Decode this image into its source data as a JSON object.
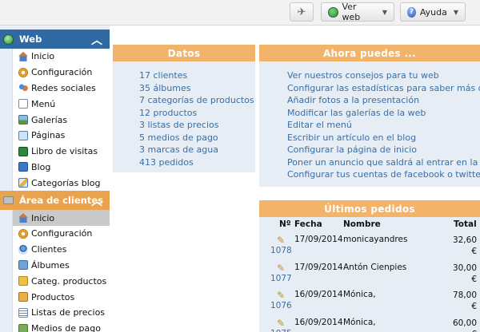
{
  "toolbar": {
    "send_icon": "paper-plane-icon",
    "view_web_label": "Ver web",
    "help_label": "Ayuda"
  },
  "sidebar": {
    "web_section": {
      "title": "Web",
      "items": [
        {
          "label": "Inicio",
          "icon": "home-icon"
        },
        {
          "label": "Configuración",
          "icon": "gear-icon"
        },
        {
          "label": "Redes sociales",
          "icon": "people-icon"
        },
        {
          "label": "Menú",
          "icon": "document-icon"
        },
        {
          "label": "Galerías",
          "icon": "image-icon"
        },
        {
          "label": "Páginas",
          "icon": "pages-icon"
        },
        {
          "label": "Libro de visitas",
          "icon": "book-icon"
        },
        {
          "label": "Blog",
          "icon": "blog-icon"
        },
        {
          "label": "Categorías blog",
          "icon": "pencil-icon"
        }
      ]
    },
    "clients_section": {
      "title": "Área de clientes",
      "items": [
        {
          "label": "Inicio",
          "icon": "home-icon"
        },
        {
          "label": "Configuración",
          "icon": "gear-icon"
        },
        {
          "label": "Clientes",
          "icon": "user-icon"
        },
        {
          "label": "Álbumes",
          "icon": "album-icon"
        },
        {
          "label": "Categ. productos",
          "icon": "folder-icon"
        },
        {
          "label": "Productos",
          "icon": "box-icon"
        },
        {
          "label": "Listas de precios",
          "icon": "list-icon"
        },
        {
          "label": "Medios de pago",
          "icon": "payment-icon"
        }
      ]
    }
  },
  "datos": {
    "title": "Datos",
    "items": [
      "17 clientes",
      "35 álbumes",
      "7 categorías de productos",
      "12 productos",
      "3 listas de precios",
      "5 medios de pago",
      "3 marcas de agua",
      "413 pedidos"
    ]
  },
  "ahora": {
    "title": "Ahora puedes ...",
    "links": [
      "Ver nuestros consejos para tu web",
      "Configurar las estadísticas para saber más de tu",
      "Añadir fotos a la presentación",
      "Modificar las galerías de la web",
      "Editar el menú",
      "Escribir un artículo en el blog",
      "Configurar la página de inicio",
      "Poner un anuncio que saldrá al entrar en la web",
      "Configurar tus cuentas de facebook o twitter"
    ]
  },
  "pedidos": {
    "title": "Últimos pedidos",
    "columns": {
      "no": "Nº",
      "fecha": "Fecha",
      "nombre": "Nombre",
      "total": "Total"
    },
    "rows": [
      {
        "no": "1078",
        "fecha": "17/09/2014",
        "nombre": "monicayandres",
        "total": "32,60",
        "currency": "€"
      },
      {
        "no": "1077",
        "fecha": "17/09/2014",
        "nombre": "Antón Cienpies",
        "total": "30,00",
        "currency": "€"
      },
      {
        "no": "1076",
        "fecha": "16/09/2014",
        "nombre": "Mónica,",
        "total": "78,00",
        "currency": "€"
      },
      {
        "no": "1075",
        "fecha": "16/09/2014",
        "nombre": "Mónica,",
        "total": "60,00",
        "currency": "€"
      }
    ]
  },
  "colors": {
    "web_section": "#2f6aa3",
    "clients_section": "#e9a24e",
    "panel_header": "#f2b36a",
    "panel_body": "#e6edf5",
    "link": "#3a6ea5"
  }
}
